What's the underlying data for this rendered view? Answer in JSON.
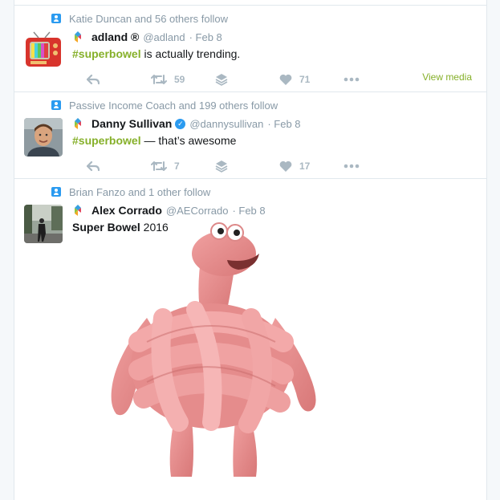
{
  "tweets": [
    {
      "context": "Katie Duncan and 56 others follow",
      "avatar": "tv-avatar",
      "name": "adland ®",
      "handle": "@adland",
      "date": "· Feb 8",
      "verified": false,
      "hashtag": "#superbowel",
      "text_rest": " is actually trending.",
      "retweets": "59",
      "likes": "71",
      "view_media": "View media"
    },
    {
      "context": "Passive Income Coach and 199 others follow",
      "avatar": "person-avatar",
      "name": "Danny Sullivan",
      "handle": "@dannysullivan",
      "date": "· Feb 8",
      "verified": true,
      "hashtag": "#superbowel",
      "text_rest": " — that’s awesome",
      "retweets": "7",
      "likes": "17"
    },
    {
      "context": "Brian Fanzo and 1 other follow",
      "avatar": "photo-avatar",
      "name": "Alex Corrado",
      "handle": "@AECorrado",
      "date": "· Feb 8",
      "verified": false,
      "text_bold": "Super Bowel",
      "text_rest": " 2016",
      "media": "pink-knotted-character-image"
    }
  ],
  "colors": {
    "hashtag": "#86b02a",
    "meta": "#8899a6",
    "action": "#aab8c2",
    "follow_icon": "#2b9bf0",
    "character": "#e98a8a"
  }
}
